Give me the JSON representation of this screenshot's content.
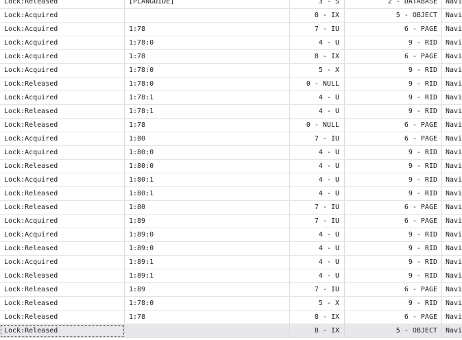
{
  "rows": [
    [
      "Lock:Released",
      "[PLANGUIDE]",
      "3 - S",
      "2 - DATABASE",
      "Navi"
    ],
    [
      "Lock:Acquired",
      "",
      "8 - IX",
      "5 - OBJECT",
      "Navi"
    ],
    [
      "Lock:Acquired",
      "1:78",
      "7 - IU",
      "6 - PAGE",
      "Navi"
    ],
    [
      "Lock:Acquired",
      "1:78:0",
      "4 - U",
      "9 - RID",
      "Navi"
    ],
    [
      "Lock:Acquired",
      "1:78",
      "8 - IX",
      "6 - PAGE",
      "Navi"
    ],
    [
      "Lock:Acquired",
      "1:78:0",
      "5 - X",
      "9 - RID",
      "Navi"
    ],
    [
      "Lock:Released",
      "1:78:0",
      "0 - NULL",
      "9 - RID",
      "Navi"
    ],
    [
      "Lock:Acquired",
      "1:78:1",
      "4 - U",
      "9 - RID",
      "Navi"
    ],
    [
      "Lock:Released",
      "1:78:1",
      "4 - U",
      "9 - RID",
      "Navi"
    ],
    [
      "Lock:Released",
      "1:78",
      "0 - NULL",
      "6 - PAGE",
      "Navi"
    ],
    [
      "Lock:Acquired",
      "1:80",
      "7 - IU",
      "6 - PAGE",
      "Navi"
    ],
    [
      "Lock:Acquired",
      "1:80:0",
      "4 - U",
      "9 - RID",
      "Navi"
    ],
    [
      "Lock:Released",
      "1:80:0",
      "4 - U",
      "9 - RID",
      "Navi"
    ],
    [
      "Lock:Acquired",
      "1:80:1",
      "4 - U",
      "9 - RID",
      "Navi"
    ],
    [
      "Lock:Released",
      "1:80:1",
      "4 - U",
      "9 - RID",
      "Navi"
    ],
    [
      "Lock:Released",
      "1:80",
      "7 - IU",
      "6 - PAGE",
      "Navi"
    ],
    [
      "Lock:Acquired",
      "1:89",
      "7 - IU",
      "6 - PAGE",
      "Navi"
    ],
    [
      "Lock:Acquired",
      "1:89:0",
      "4 - U",
      "9 - RID",
      "Navi"
    ],
    [
      "Lock:Released",
      "1:89:0",
      "4 - U",
      "9 - RID",
      "Navi"
    ],
    [
      "Lock:Acquired",
      "1:89:1",
      "4 - U",
      "9 - RID",
      "Navi"
    ],
    [
      "Lock:Released",
      "1:89:1",
      "4 - U",
      "9 - RID",
      "Navi"
    ],
    [
      "Lock:Released",
      "1:89",
      "7 - IU",
      "6 - PAGE",
      "Navi"
    ],
    [
      "Lock:Released",
      "1:78:0",
      "5 - X",
      "9 - RID",
      "Navi"
    ],
    [
      "Lock:Released",
      "1:78",
      "8 - IX",
      "6 - PAGE",
      "Navi"
    ],
    [
      "Lock:Released",
      "",
      "8 - IX",
      "5 - OBJECT",
      "Navi"
    ]
  ]
}
